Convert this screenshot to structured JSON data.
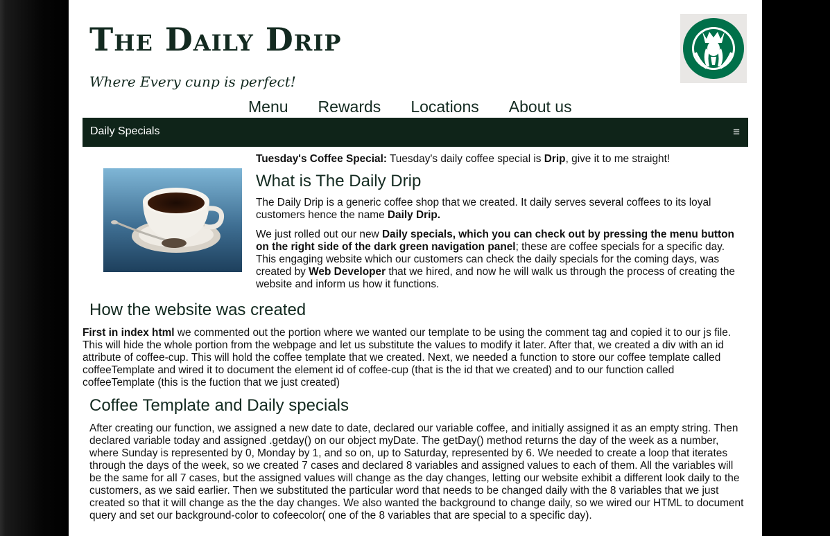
{
  "header": {
    "title": "The Daily Drip",
    "tagline": "Where Every cunp is perfect!",
    "logo_icon": "siren-logo-icon",
    "logo_color": "#00704A"
  },
  "nav": {
    "items": [
      "Menu",
      "Rewards",
      "Locations",
      "About us"
    ]
  },
  "navbar": {
    "label": "Daily Specials",
    "menu_icon": "hamburger-menu-icon",
    "color": "#0f2419"
  },
  "special": {
    "label": "Tuesday's Coffee Special:",
    "text_before": " Tuesday's daily coffee special is ",
    "coffee": "Drip",
    "text_after": ", give it to me straight!"
  },
  "what": {
    "heading": "What is The Daily Drip",
    "p1_text": "The Daily Drip is a generic coffee shop that we created. It daily serves several coffees to its loyal customers hence the name ",
    "p1_bold": "Daily Drip.",
    "p2_before": "We just rolled out our new ",
    "p2_bold": "Daily specials, which you can check out by pressing the menu button on the right side of the dark green navigation panel",
    "p2_mid": "; these are coffee specials for a specific day. This engaging website which our customers can check the daily specials for the coming days, was created by ",
    "p2_bold2": "Web Developer",
    "p2_after": " that we hired, and now he will walk us through the process of creating the website and inform us how it functions."
  },
  "how": {
    "heading": "How the website was created",
    "bold": "First in index html",
    "text": " we commented out the portion where we wanted our template to be using the comment tag and copied it to our js file. This will hide the whole portion from the webpage and let us substitute the values to modify it later. After that, we created a div with an id attribute of coffee-cup. This will hold the coffee template that we created. Next, we needed a function to store our coffee template called coffeeTemplate and wired it to document the element id of coffee-cup (that is the id that we created) and to our function called coffeeTemplate (this is the fuction that we just created)"
  },
  "template": {
    "heading": "Coffee Template and Daily specials",
    "text": "After creating our function, we assigned a new date to date, declared our variable coffee, and initially assigned it as an empty string. Then declared variable today and assigned .getday() on our object myDate. The getDay() method returns the day of the week as a number, where Sunday is represented by 0, Monday by 1, and so on, up to Saturday, represented by 6. We needed to create a loop that iterates through the days of the week, so we created 7 cases and declared 8 variables and assigned values to each of them. All the variables will be the same for all 7 cases, but the assigned values will change as the day changes, letting our website exhibit a different look daily to the customers, as we said earlier. Then we substituted the particular word that needs to be changed daily with the 8 variables that we just created so that it will change as the the day changes. We also wanted the background to change daily, so we wired our HTML to document query and set our background-color to cofeecolor( one of the 8 variables that are special to a specific day)."
  },
  "image": {
    "icon": "coffee-cup-photo"
  }
}
